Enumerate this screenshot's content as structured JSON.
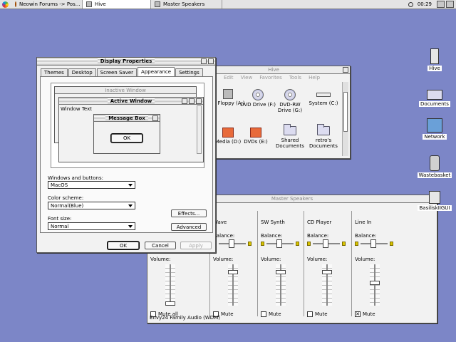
{
  "taskbar": {
    "tasks": [
      "Neowin Forums -> Pos...",
      "Hive",
      "Master Speakers"
    ],
    "clock": "00:29"
  },
  "display_properties": {
    "title": "Display Properties",
    "tabs": [
      "Themes",
      "Desktop",
      "Screen Saver",
      "Appearance",
      "Settings"
    ],
    "selected_tab": "Appearance",
    "preview": {
      "inactive_title": "Inactive Window",
      "active_title": "Active Window",
      "window_text": "Window Text",
      "message_title": "Message Box",
      "ok": "OK"
    },
    "windows_buttons_label": "Windows and buttons:",
    "windows_buttons_value": "MacOS",
    "color_scheme_label": "Color scheme:",
    "color_scheme_value": "Normal(Blue)",
    "font_size_label": "Font size:",
    "font_size_value": "Normal",
    "effects_btn": "Effects...",
    "advanced_btn": "Advanced",
    "ok_btn": "OK",
    "cancel_btn": "Cancel",
    "apply_btn": "Apply"
  },
  "hive": {
    "title": "Hive",
    "menu": [
      "Edit",
      "View",
      "Favorites",
      "Tools",
      "Help"
    ],
    "items": [
      {
        "label": "½ Floppy (A:)",
        "kind": "floppy"
      },
      {
        "label": "DVD Drive (F:)",
        "kind": "disc"
      },
      {
        "label": "DVD-RW Drive (G:)",
        "kind": "disc"
      },
      {
        "label": "System (C:)",
        "kind": "drive"
      },
      {
        "label": "Media (D:)",
        "kind": "media"
      },
      {
        "label": "DVDs (E:)",
        "kind": "media"
      },
      {
        "label": "Shared Documents",
        "kind": "folder"
      },
      {
        "label": "retro's Documents",
        "kind": "folder"
      }
    ]
  },
  "mixer": {
    "title": "Master Speakers",
    "balance_label": "Balance:",
    "volume_label": "Volume:",
    "channels": [
      {
        "name": "",
        "mute": "Mute all",
        "muted": false,
        "level": 0.0,
        "balance": false
      },
      {
        "name": "Wave",
        "mute": "Mute",
        "muted": false,
        "level": 0.85,
        "balance": true
      },
      {
        "name": "SW Synth",
        "mute": "Mute",
        "muted": false,
        "level": 0.85,
        "balance": true
      },
      {
        "name": "CD Player",
        "mute": "Mute",
        "muted": false,
        "level": 0.85,
        "balance": true
      },
      {
        "name": "Line In",
        "mute": "Mute",
        "muted": true,
        "level": 0.55,
        "balance": true
      }
    ],
    "device": "Envy24 Family Audio (WDM)"
  },
  "desktop_icons": [
    "Hive",
    "Documents",
    "Network",
    "Wastebasket",
    "BasiliskIIGUI"
  ]
}
